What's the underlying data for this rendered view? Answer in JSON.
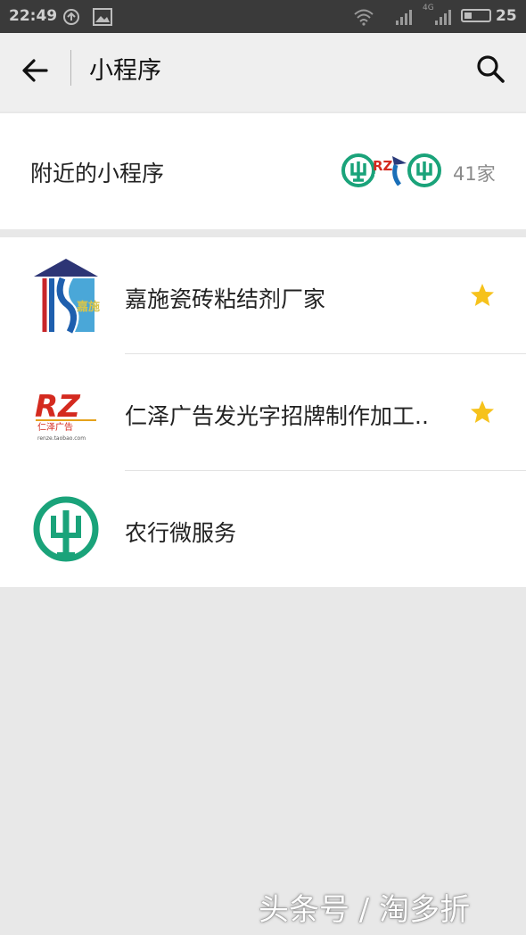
{
  "status_bar": {
    "time": "22:49",
    "battery": "25",
    "network": "4G"
  },
  "nav": {
    "title": "小程序",
    "back_icon": "arrow-left-icon",
    "search_icon": "search-icon"
  },
  "nearby": {
    "label": "附近的小程序",
    "count": "41家"
  },
  "items": [
    {
      "name": "嘉施瓷砖粘结剂厂家",
      "starred": true,
      "logo_text": "嘉施"
    },
    {
      "name": "仁泽广告发光字招牌制作加工..",
      "starred": true,
      "logo_text": "仁泽广告",
      "logo_sub": "renze.taobao.com"
    },
    {
      "name": "农行微服务",
      "starred": false
    }
  ],
  "watermark": "头条号 / 淘多折",
  "colors": {
    "star": "#f6c21c",
    "agri_green": "#1aa37a",
    "rz_red": "#d42a1f",
    "nav_bg": "#efefef",
    "page_bg": "#e8e8e8"
  }
}
